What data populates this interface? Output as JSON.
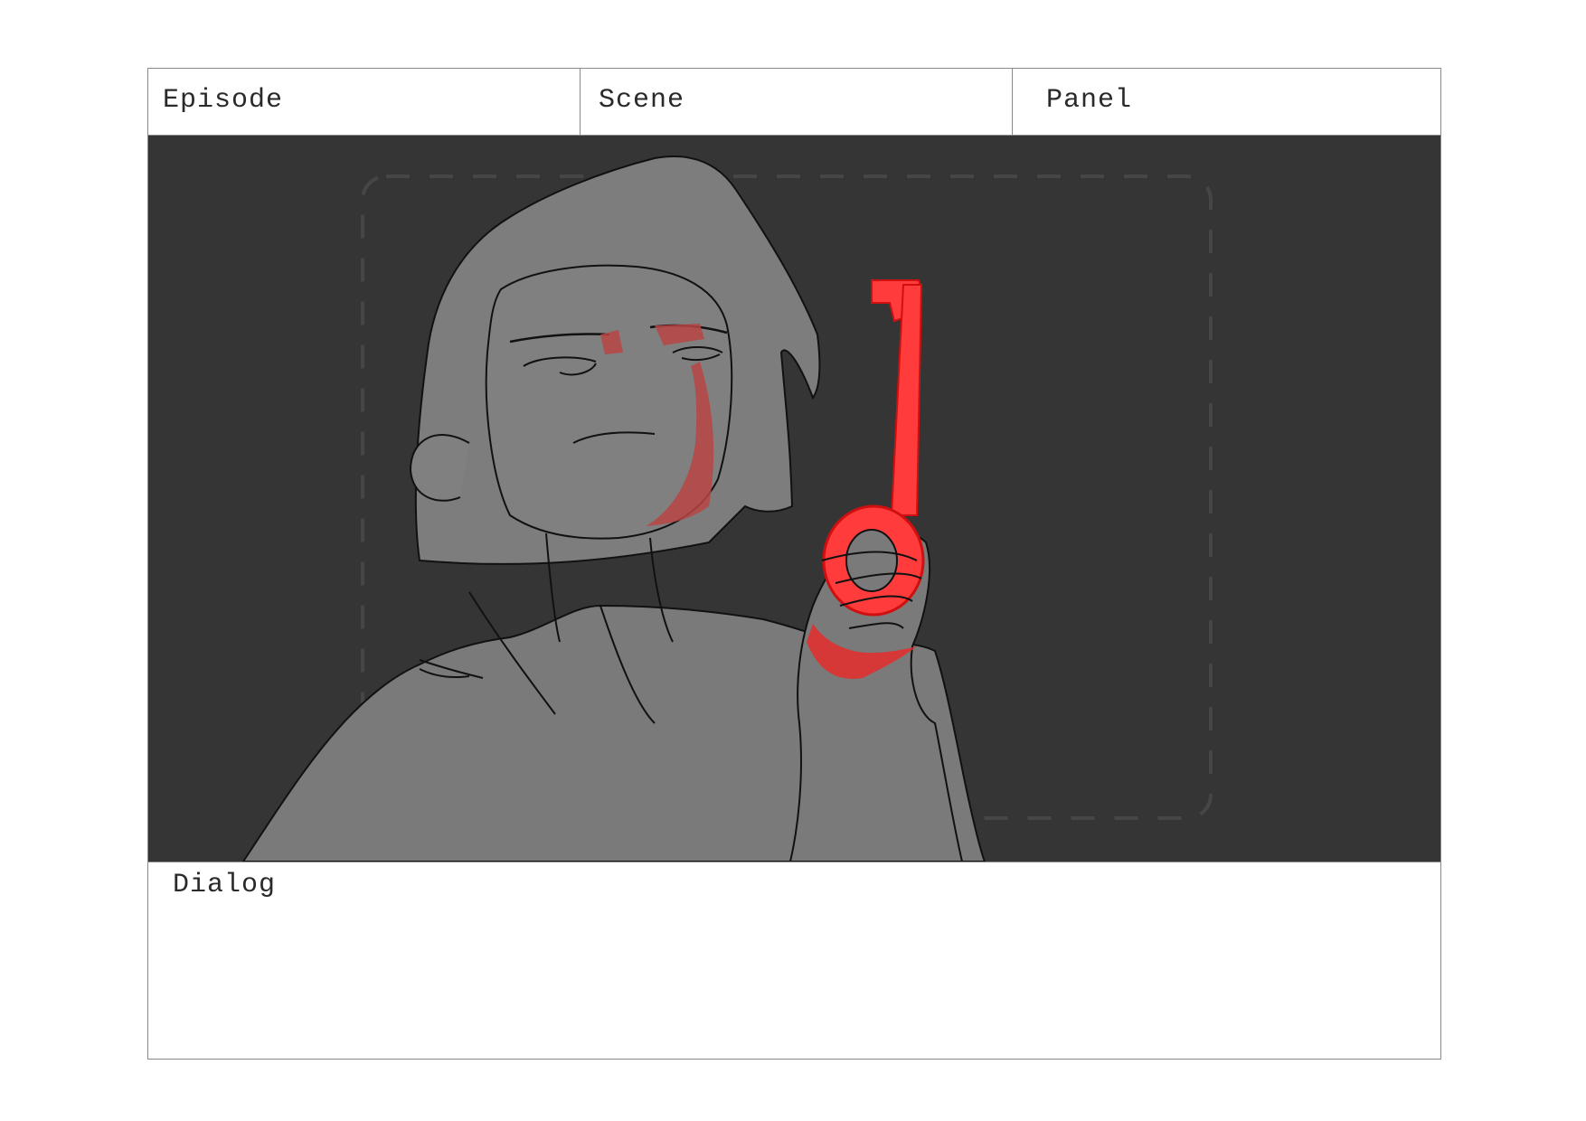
{
  "storyboard": {
    "header": {
      "episode_label": "Episode",
      "scene_label": "Scene",
      "panel_label": "Panel"
    },
    "dialog": {
      "label": "Dialog",
      "text": ""
    },
    "artwork": {
      "subject": "sketch of a character holding up a key",
      "accent_color": "#ff3b3b",
      "figure_color": "#7a7a7a",
      "background_color": "#353535",
      "safe_frame": "dashed rounded rectangle"
    }
  }
}
